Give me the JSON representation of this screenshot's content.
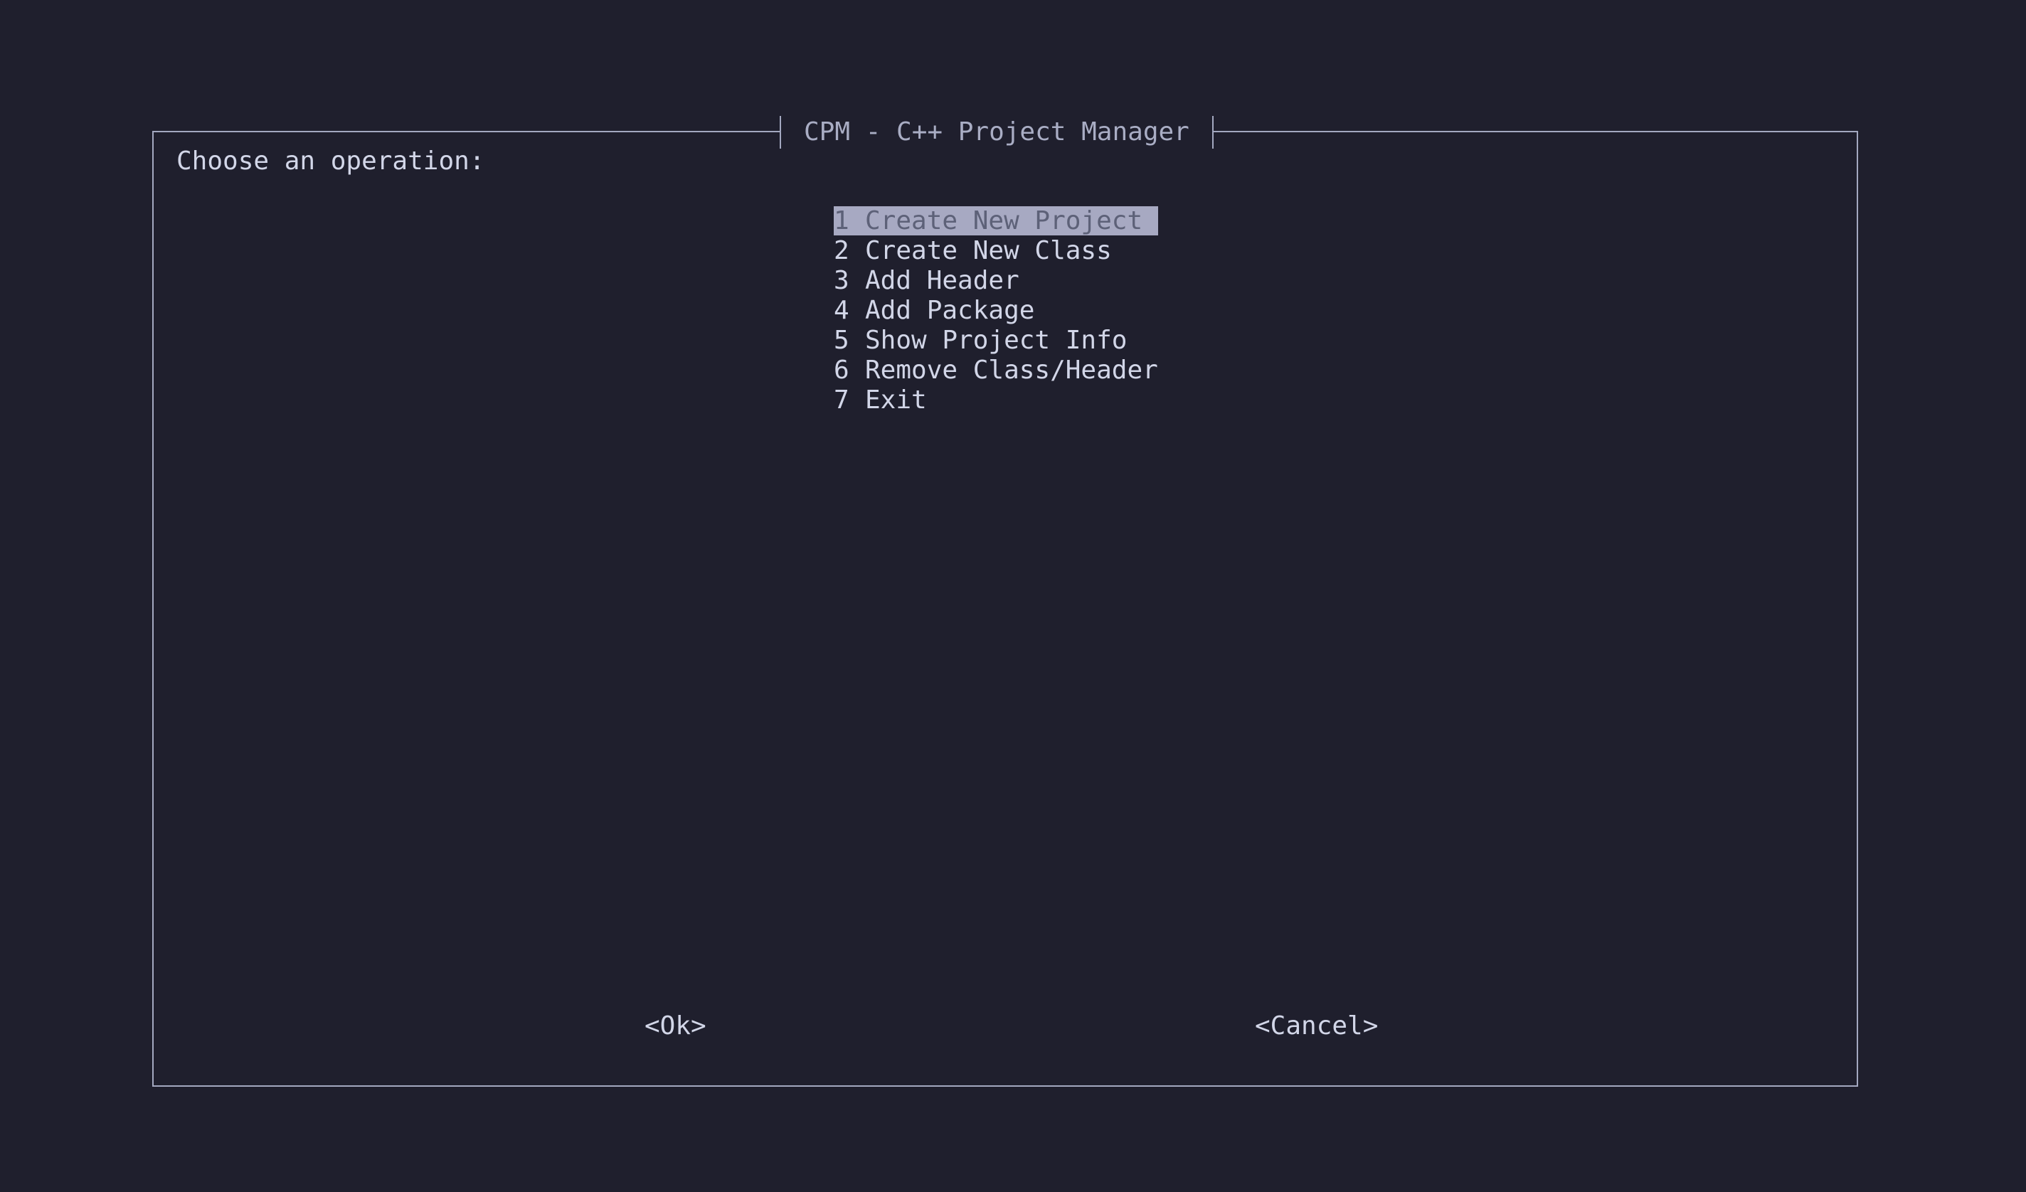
{
  "dialog": {
    "title": "CPM - C++ Project Manager",
    "prompt": "Choose an operation:",
    "menu": [
      {
        "key": "1",
        "label": "Create New Project",
        "selected": true
      },
      {
        "key": "2",
        "label": "Create New Class",
        "selected": false
      },
      {
        "key": "3",
        "label": "Add Header",
        "selected": false
      },
      {
        "key": "4",
        "label": "Add Package",
        "selected": false
      },
      {
        "key": "5",
        "label": "Show Project Info",
        "selected": false
      },
      {
        "key": "6",
        "label": "Remove Class/Header",
        "selected": false
      },
      {
        "key": "7",
        "label": "Exit",
        "selected": false
      }
    ],
    "buttons": {
      "ok": "<Ok>",
      "cancel": "<Cancel>"
    }
  },
  "colors": {
    "background": "#1f1f2d",
    "border": "#a3a8c0",
    "text": "#d2d6e8",
    "selection_bg": "#a7a9c2",
    "selection_text": "#5d6178"
  }
}
